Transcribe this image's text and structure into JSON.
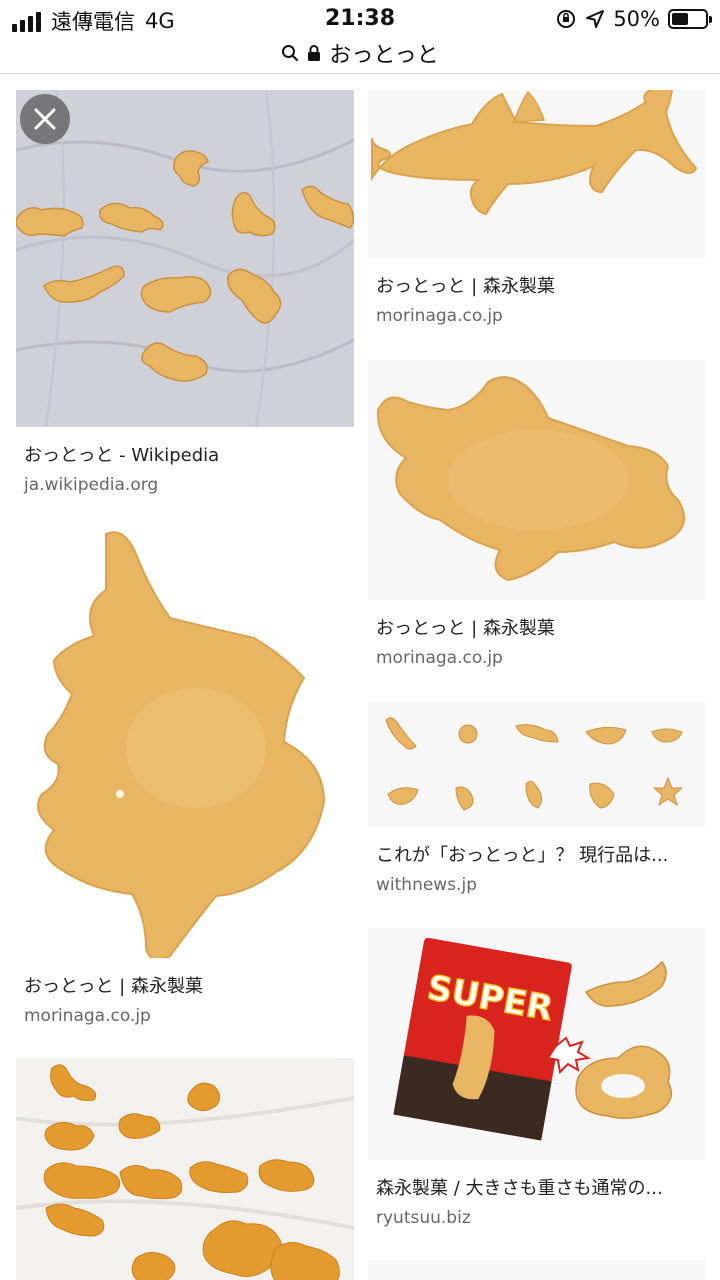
{
  "status_bar": {
    "carrier": "遠傳電信",
    "network": "4G",
    "time": "21:38",
    "battery": "50%",
    "battery_level": 0.5
  },
  "url_bar": {
    "query": "おっとっと",
    "icons": [
      "search-icon",
      "lock-icon"
    ]
  },
  "colors": {
    "snack": "#e8b563",
    "snack_dark": "#c9913f",
    "orange_snack": "#e39a2e",
    "cloth": "#cfd0d8",
    "bag_red": "#d8231f"
  },
  "results": [
    {
      "caption": "おっとっと - Wikipedia",
      "domain": "ja.wikipedia.org"
    },
    {
      "caption": "おっとっと | 森永製菓",
      "domain": "morinaga.co.jp"
    },
    {
      "caption": "おっとっと | 森永製菓",
      "domain": "morinaga.co.jp"
    },
    {
      "caption": "おっとっと | 森永製菓",
      "domain": "morinaga.co.jp"
    },
    {
      "caption": "これが「おっとっと」？ 現行品は...",
      "domain": "withnews.jp"
    },
    {
      "caption": "森永製菓 / 大きさも重さも通常の...",
      "domain": "ryutsuu.biz"
    }
  ],
  "package": {
    "brand": "SUPER"
  }
}
